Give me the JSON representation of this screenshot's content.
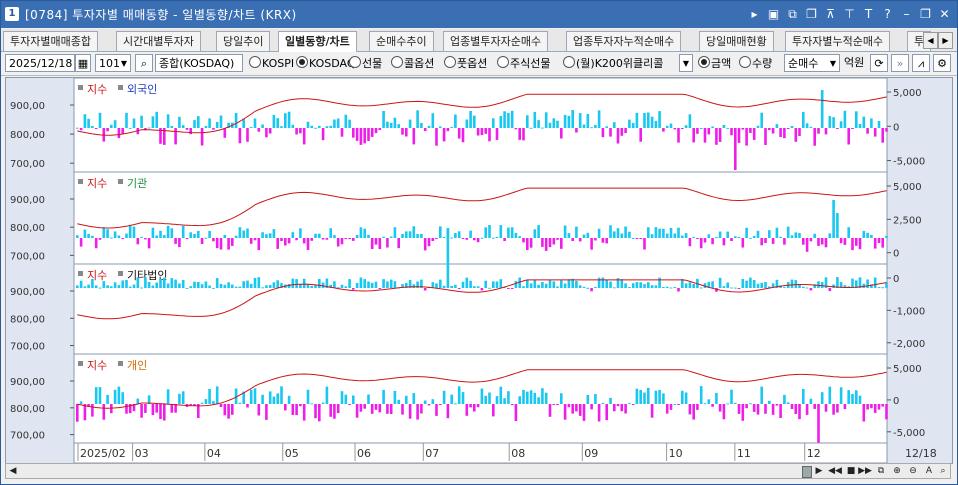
{
  "window": {
    "number": "1",
    "title": "[0784] 투자자별 매매동향 - 일별동향/차트 (KRX)"
  },
  "tabs": [
    "투자자별매매종합",
    "시간대별투자자",
    "당일추이",
    "일별동향/차트",
    "순매수추이",
    "업종별투자자순매수",
    "업종투자자누적순매수",
    "당일매매현황",
    "투자자별누적순매수",
    "투"
  ],
  "toolbar": {
    "date": "2025/12/18",
    "code": "101",
    "index_name": "종합(KOSDAQ)",
    "market_options": [
      "KOSPI",
      "KOSDAQ",
      "선물",
      "콜옵션",
      "풋옵션",
      "주식선물",
      "(월)K200위클리콜"
    ],
    "market_selected": "KOSDAQ",
    "unit_options": [
      "금액",
      "수량"
    ],
    "unit_selected": "금액",
    "mode": "순매수",
    "unit_label": "억원"
  },
  "panels": [
    {
      "index_label": "지수",
      "investor": "외국인",
      "investor_color": "#1f3fbf",
      "right_ticks": [
        "5,000",
        "0",
        "-5,000"
      ]
    },
    {
      "index_label": "지수",
      "investor": "기관",
      "investor_color": "#1f8f3f",
      "right_ticks": [
        "5,000",
        "2,500",
        "0"
      ]
    },
    {
      "index_label": "지수",
      "investor": "기타법인",
      "investor_color": "#111111",
      "right_ticks": [
        "0",
        "-1,000",
        "-2,000"
      ]
    },
    {
      "index_label": "지수",
      "investor": "개인",
      "investor_color": "#d46a00",
      "right_ticks": [
        "5,000",
        "0",
        "-5,000"
      ]
    }
  ],
  "left_ticks": [
    "900,00",
    "800,00",
    "700,00"
  ],
  "x_labels": [
    "2025/02",
    "03",
    "04",
    "05",
    "06",
    "07",
    "08",
    "09",
    "10",
    "11",
    "12"
  ],
  "x_end_label": "12/18",
  "colors": {
    "positive": "#ee1ee8",
    "negative": "#18c8f0",
    "index_line": "#cc1515"
  }
}
